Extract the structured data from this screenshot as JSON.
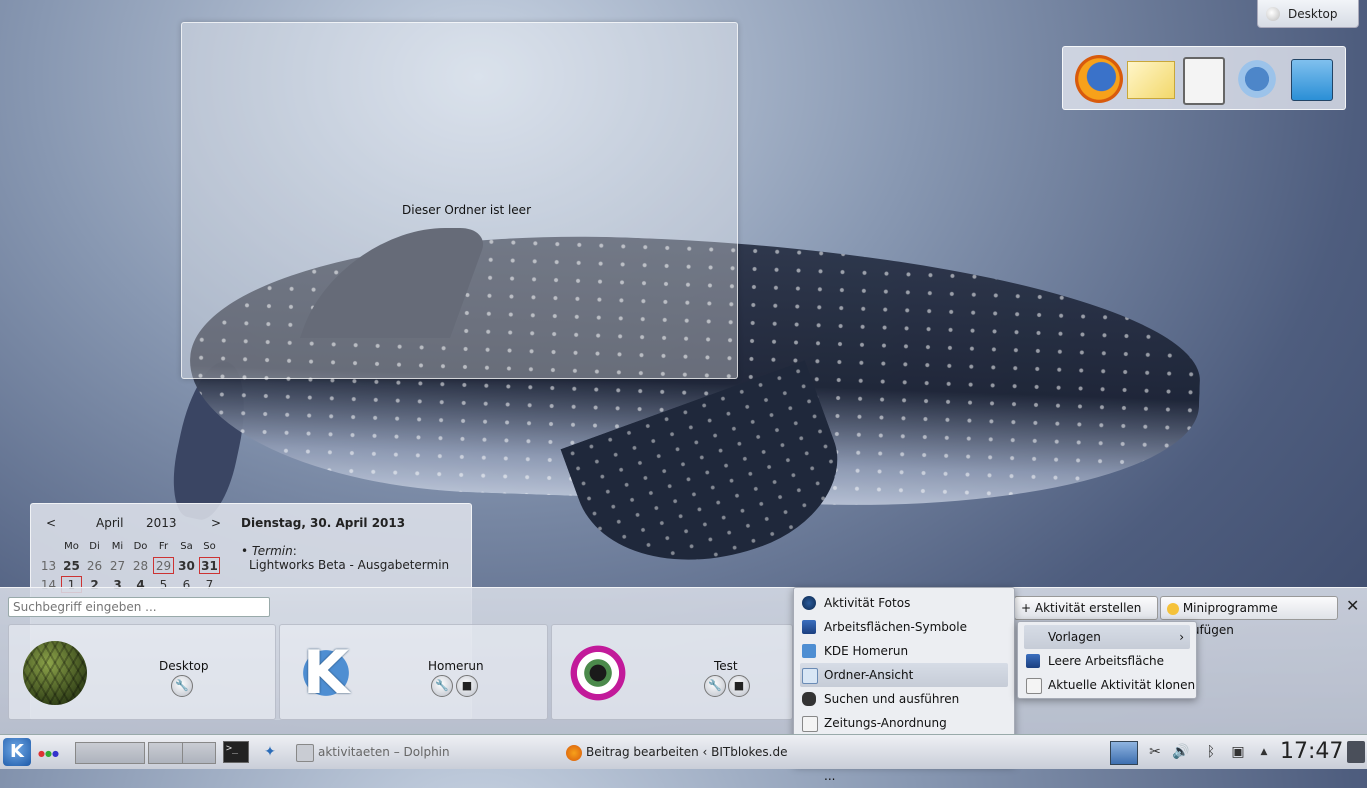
{
  "desktop": {
    "toolbox_label": "Desktop",
    "folder_empty_text": "Dieser Ordner ist leer"
  },
  "calendar": {
    "prev": "<",
    "next": ">",
    "month": "April",
    "year": "2013",
    "weekdays": [
      "Mo",
      "Di",
      "Mi",
      "Do",
      "Fr",
      "Sa",
      "So"
    ],
    "rows": [
      [
        "13",
        "25",
        "26",
        "27",
        "28",
        "29",
        "30",
        "31"
      ],
      [
        "14",
        "1",
        "2",
        "3",
        "4",
        "5",
        "6",
        "7"
      ]
    ],
    "event_date": "Dienstag, 30. April 2013",
    "event_label": "Termin",
    "event_title": "Lightworks Beta - Ausgabetermin"
  },
  "activities": {
    "search_placeholder": "Suchbegriff eingeben ...",
    "cards": [
      {
        "title": "Desktop"
      },
      {
        "title": "Homerun"
      },
      {
        "title": "Test"
      }
    ],
    "create_label": "Aktivität erstellen ...",
    "widgets_label": "Miniprogramme hinzufügen",
    "close": "✕"
  },
  "create_menu": {
    "items": [
      {
        "label": "Aktivität Fotos",
        "icon": "photo-activity-icon"
      },
      {
        "label": "Arbeitsflächen-Symbole",
        "icon": "desktop-icons-icon"
      },
      {
        "label": "KDE Homerun",
        "icon": "homerun-icon"
      },
      {
        "label": "Ordner-Ansicht",
        "icon": "folder-view-icon"
      },
      {
        "label": "Suchen und ausführen",
        "icon": "binoculars-icon"
      },
      {
        "label": "Zeitungs-Anordnung",
        "icon": "newspaper-icon"
      },
      {
        "label": "Neue Vorlagen herunterladen ...",
        "icon": "star-icon"
      }
    ]
  },
  "sub_menu": {
    "items": [
      {
        "label": "Vorlagen"
      },
      {
        "label": "Leere Arbeitsfläche"
      },
      {
        "label": "Aktuelle Aktivität klonen"
      }
    ],
    "arrow": "›"
  },
  "taskbar": {
    "kmenu": "K",
    "tasks": [
      {
        "label": "aktivitaeten – Dolphin"
      },
      {
        "label": "Beitrag bearbeiten ‹ BITblokes.de | Lin"
      }
    ],
    "terminal": ">_",
    "clock": "17:47"
  },
  "colors": {
    "accent": "#2b6cb8",
    "holiday_border": "#cc3333"
  }
}
